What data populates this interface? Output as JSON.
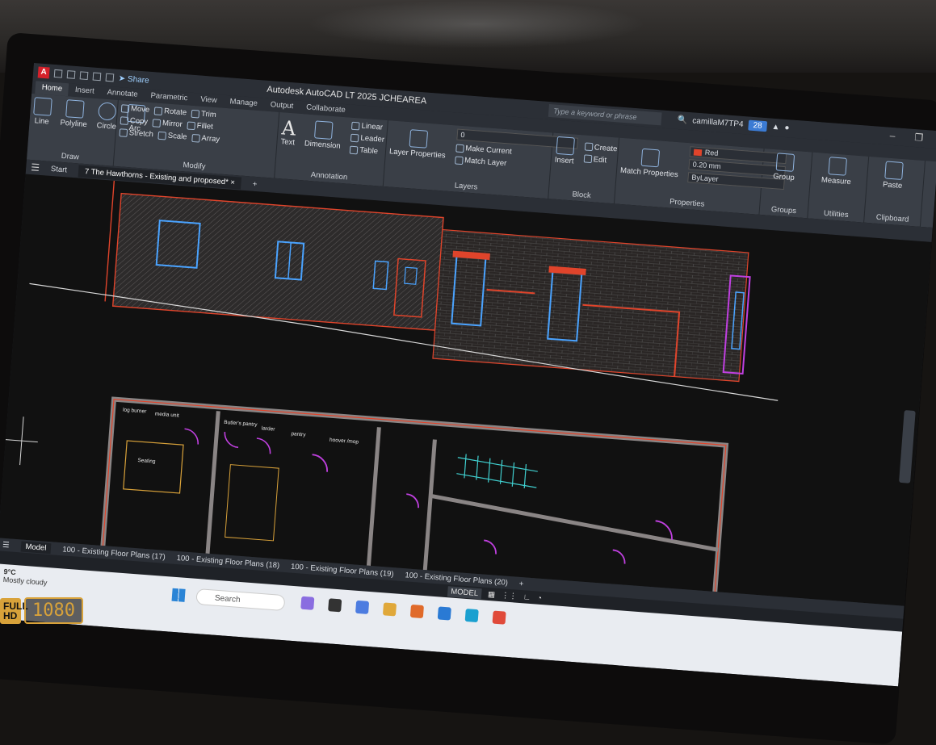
{
  "app": {
    "title": "Autodesk AutoCAD LT 2025  JCHEAREA",
    "logo": "A",
    "share_label": "Share",
    "search_placeholder": "Type a keyword or phrase",
    "user": "camillaM7TP4",
    "cloud_badge": "28"
  },
  "ribbon_tabs": [
    "Home",
    "Insert",
    "Annotate",
    "Parametric",
    "View",
    "Manage",
    "Output",
    "Collaborate"
  ],
  "ribbon": {
    "draw": {
      "title": "Draw",
      "tools": [
        "Line",
        "Polyline",
        "Circle",
        "Arc"
      ]
    },
    "modify": {
      "title": "Modify",
      "row1": [
        "Move",
        "Rotate",
        "Trim"
      ],
      "row2": [
        "Copy",
        "Mirror",
        "Fillet"
      ],
      "row3": [
        "Stretch",
        "Scale",
        "Array"
      ]
    },
    "annotation": {
      "title": "Annotation",
      "text": "Text",
      "dimension": "Dimension",
      "linear": "Linear",
      "leader": "Leader",
      "table": "Table"
    },
    "layers": {
      "title": "Layers",
      "layer_properties": "Layer Properties",
      "current": "0",
      "make_current": "Make Current",
      "match_layer": "Match Layer"
    },
    "block": {
      "title": "Block",
      "insert": "Insert",
      "create": "Create",
      "edit": "Edit"
    },
    "properties": {
      "title": "Properties",
      "match": "Match Properties",
      "color": "Red",
      "lineweight": "0.20 mm",
      "linetype": "ByLayer"
    },
    "groups": {
      "title": "Groups",
      "group": "Group"
    },
    "utilities": {
      "title": "Utilities",
      "measure": "Measure"
    },
    "clipboard": {
      "title": "Clipboard",
      "paste": "Paste"
    }
  },
  "doc_tabs": {
    "start": "Start",
    "active": "7 The Hawthorns - Existing and proposed*"
  },
  "layout_tabs": [
    "Model",
    "100 - Existing Floor Plans (17)",
    "100 - Existing Floor Plans (18)",
    "100 - Existing Floor Plans (19)",
    "100 - Existing Floor Plans (20)"
  ],
  "status": {
    "model": "MODEL"
  },
  "drawing_labels": [
    "log burner",
    "media unit",
    "Butler's pantry",
    "larder",
    "pantry",
    "hoover /mop",
    "Seating"
  ],
  "taskbar": {
    "temp": "9°C",
    "weather": "Mostly cloudy",
    "search": "Search"
  },
  "badge": {
    "full": "FULL HD",
    "res": "1080"
  },
  "colors": {
    "accent": "#3b7bd4",
    "wall_red": "#e0442b",
    "window_blue": "#4aa3ff",
    "door_magenta": "#c040e0",
    "stair_cyan": "#40d0d0"
  }
}
